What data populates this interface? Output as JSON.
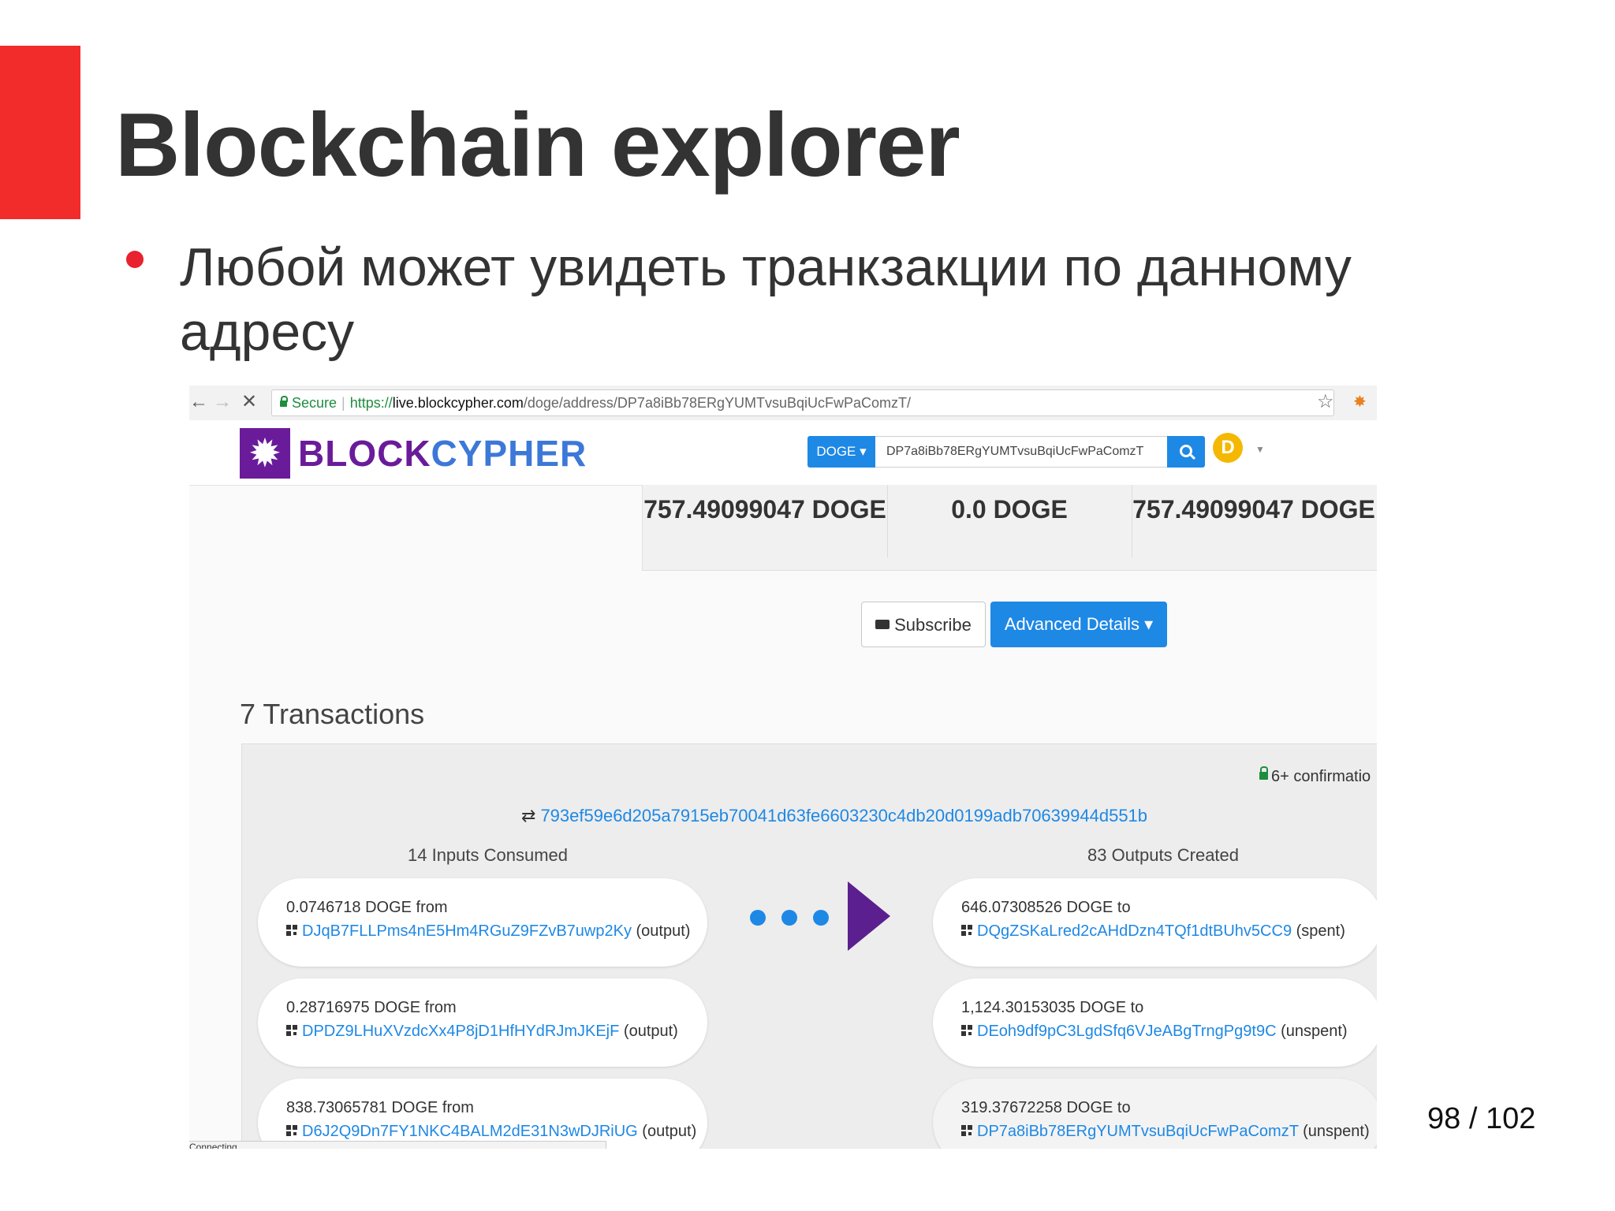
{
  "slide": {
    "title": "Blockchain explorer",
    "bullet": "Любой может увидеть транкзакции по данному адресу",
    "page_number": "98 / 102",
    "accent_color": "#f22b2b"
  },
  "browser": {
    "back_icon": "←",
    "forward_icon": "→",
    "stop_icon": "✕",
    "secure_label": "Secure",
    "url_scheme": "https://",
    "url_host": "live.blockcypher.com",
    "url_path": "/doge/address/DP7a8iBb78ERgYUMTvsuBqiUcFwPaComzT/",
    "star_icon": "☆",
    "status_text": "Connecting..."
  },
  "site": {
    "logo_part1": "BLOCK",
    "logo_part2": "CYPHER",
    "brand_purple": "#6a1b9a",
    "brand_blue": "#3c78d8",
    "coin_selector": "DOGE ▾",
    "search_value": "DP7a8iBb78ERgYUMTvsuBqiUcFwPaComzT",
    "doge_badge": "D"
  },
  "balances": [
    "757.49099047 DOGE",
    "0.0 DOGE",
    "757.49099047 DOGE"
  ],
  "actions": {
    "subscribe_label": "Subscribe",
    "advanced_label": "Advanced Details ▾"
  },
  "transactions": {
    "count_label": "7 Transactions",
    "confirmations": "6+ confirmatio",
    "tx_hash": "793ef59e6d205a7915eb70041d63fe6603230c4db20d0199adb70639944d551b",
    "inputs_header": "14 Inputs Consumed",
    "outputs_header": "83 Outputs Created",
    "inputs": [
      {
        "amount": "0.0746718 DOGE from",
        "address": "DJqB7FLLPms4nE5Hm4RGuZ9FZvB7uwp2Ky",
        "status": "(output)"
      },
      {
        "amount": "0.28716975 DOGE from",
        "address": "DPDZ9LHuXVzdcXx4P8jD1HfHYdRJmJKEjF",
        "status": "(output)"
      },
      {
        "amount": "838.73065781 DOGE from",
        "address": "D6J2Q9Dn7FY1NKC4BALM2dE31N3wDJRiUG",
        "status": "(output)"
      }
    ],
    "outputs": [
      {
        "amount": "646.07308526 DOGE to",
        "address": "DQgZSKaLred2cAHdDzn4TQf1dtBUhv5CC9",
        "status": "(spent)"
      },
      {
        "amount": "1,124.30153035 DOGE to",
        "address": "DEoh9df9pC3LgdSfq6VJeABgTrngPg9t9C",
        "status": "(unspent)"
      },
      {
        "amount": "319.37672258 DOGE to",
        "address": "DP7a8iBb78ERgYUMTvsuBqiUcFwPaComzT",
        "status": "(unspent)"
      }
    ]
  }
}
